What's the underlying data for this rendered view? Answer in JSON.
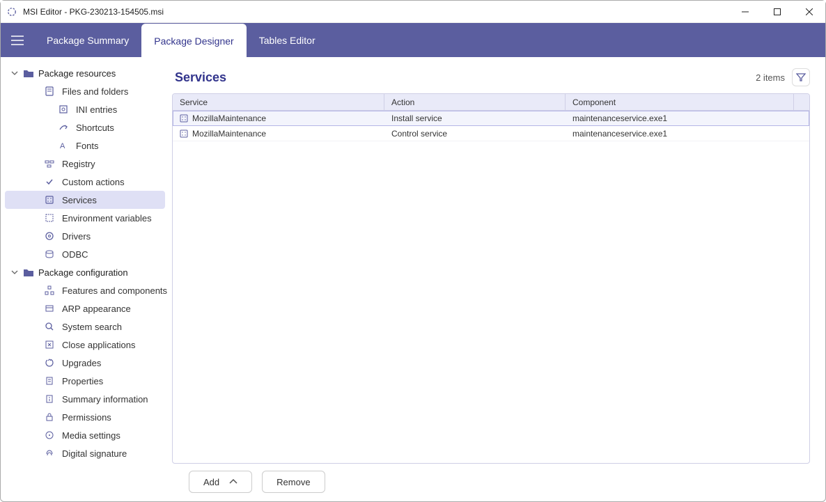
{
  "window": {
    "title": "MSI Editor - PKG-230213-154505.msi"
  },
  "tabs": {
    "summary": "Package Summary",
    "designer": "Package Designer",
    "tables": "Tables Editor"
  },
  "sidebar": {
    "group_resources": "Package resources",
    "group_config": "Package configuration",
    "items": {
      "files": "Files and folders",
      "ini": "INI entries",
      "shortcuts": "Shortcuts",
      "fonts": "Fonts",
      "registry": "Registry",
      "custom": "Custom actions",
      "services": "Services",
      "env": "Environment variables",
      "drivers": "Drivers",
      "odbc": "ODBC",
      "features": "Features and components",
      "arp": "ARP appearance",
      "search": "System search",
      "closeapps": "Close applications",
      "upgrades": "Upgrades",
      "properties": "Properties",
      "sumi": "Summary information",
      "perm": "Permissions",
      "media": "Media settings",
      "digsig": "Digital signature"
    }
  },
  "content": {
    "title": "Services",
    "count": "2 items",
    "columns": {
      "service": "Service",
      "action": "Action",
      "component": "Component"
    },
    "rows": [
      {
        "service": "MozillaMaintenance",
        "action": "Install service",
        "component": "maintenanceservice.exe1"
      },
      {
        "service": "MozillaMaintenance",
        "action": "Control service",
        "component": "maintenanceservice.exe1"
      }
    ]
  },
  "buttons": {
    "add": "Add",
    "remove": "Remove"
  }
}
